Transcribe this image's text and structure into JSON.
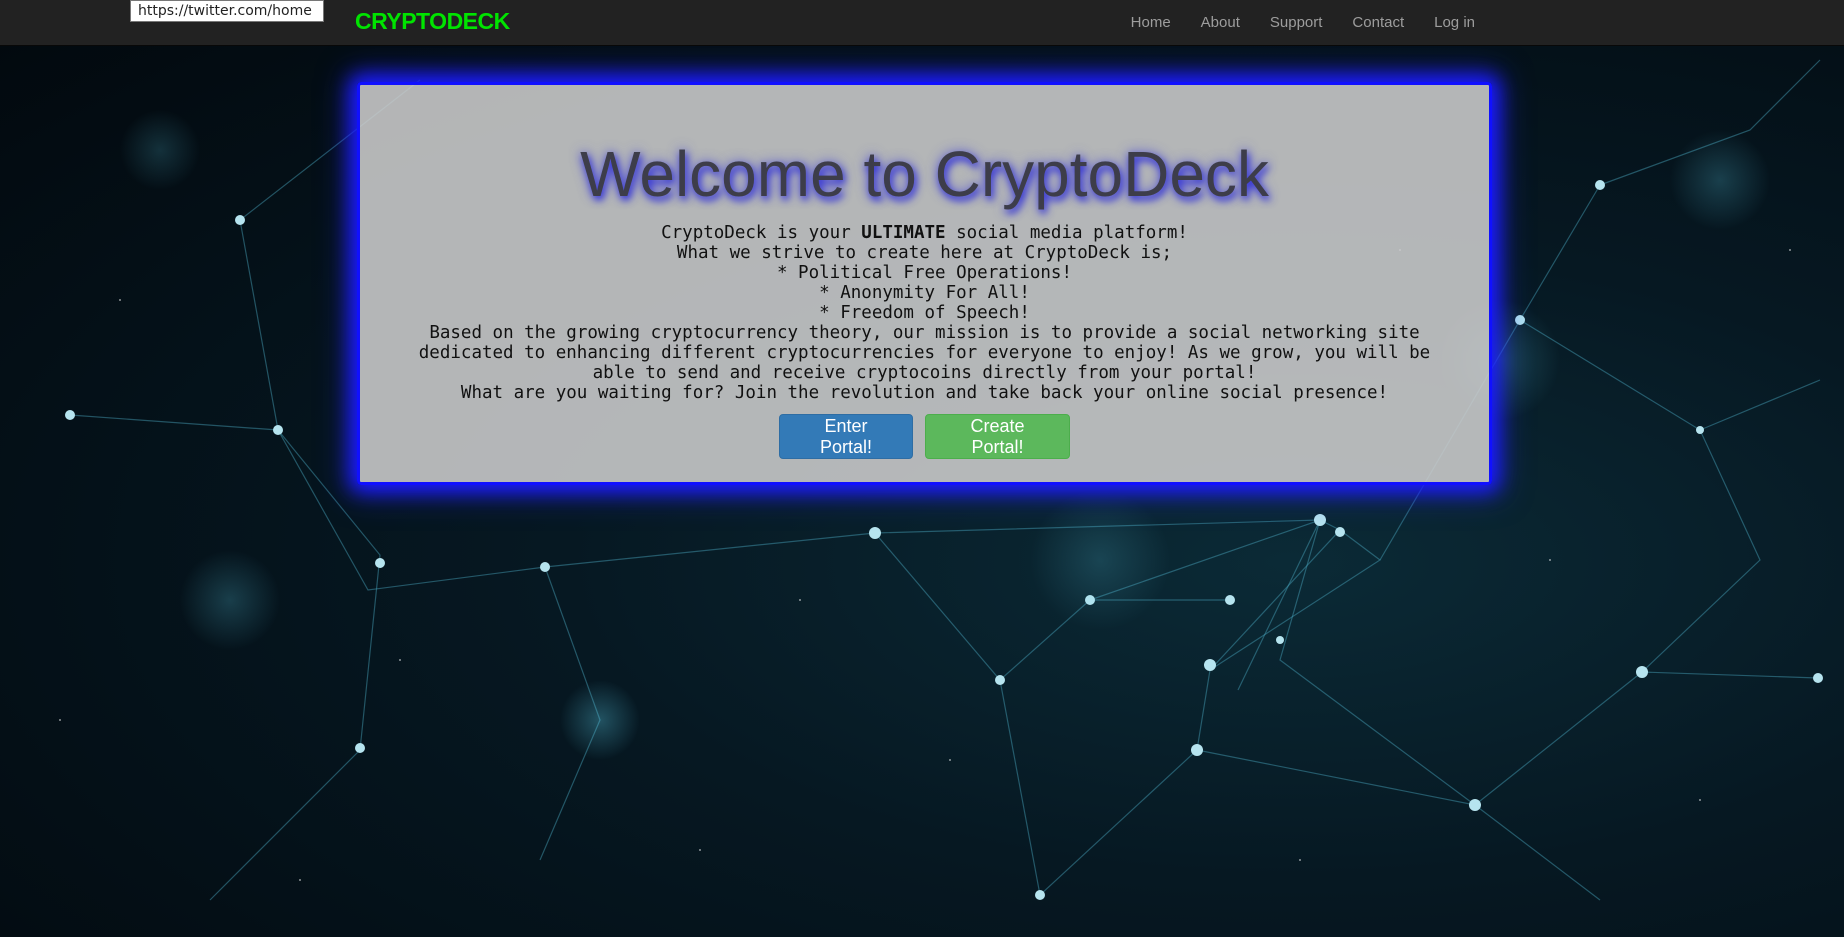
{
  "tooltip": {
    "url": "https://twitter.com/home"
  },
  "navbar": {
    "brand": "CRYPTODECK",
    "links": [
      {
        "label": "Home"
      },
      {
        "label": "About"
      },
      {
        "label": "Support"
      },
      {
        "label": "Contact"
      },
      {
        "label": "Log in"
      }
    ]
  },
  "hero": {
    "title": "Welcome to CryptoDeck",
    "intro_prefix": "CryptoDeck is your ",
    "intro_emphasis": "ULTIMATE",
    "intro_suffix": " social media platform!",
    "line2": "What we strive to create here at CryptoDeck is;",
    "bullets": [
      "* Political Free Operations!",
      "* Anonymity For All!",
      "* Freedom of Speech!"
    ],
    "mission": "Based on the growing cryptocurrency theory, our mission is to provide a social networking site dedicated to enhancing different cryptocurrencies for everyone to enjoy! As we grow, you will be able to send and receive cryptocoins directly from your portal!",
    "cta": "What are you waiting for? Join the revolution and take back your online social presence!",
    "enter_button": "Enter Portal!",
    "create_button": "Create Portal!"
  },
  "colors": {
    "brand": "#00e400",
    "panel_border": "#1010ff",
    "primary_button": "#337ab7",
    "success_button": "#5cb85c",
    "navbar_bg": "#222222"
  }
}
